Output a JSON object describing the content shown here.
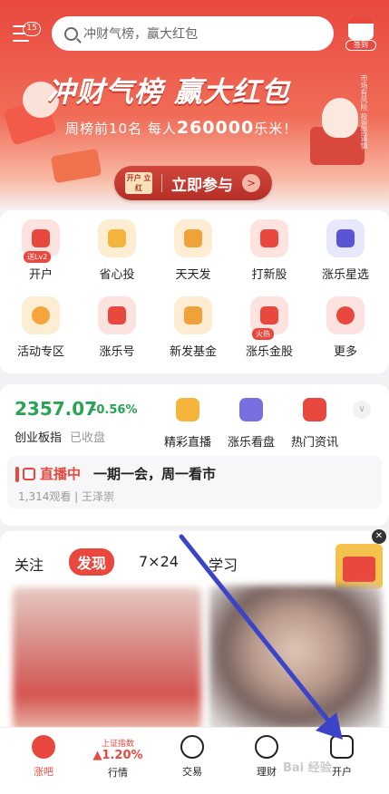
{
  "header": {
    "menu_badge": "15",
    "search_placeholder": "冲财气榜，赢大红包",
    "checkin_label": "签到"
  },
  "banner": {
    "title": "冲财气榜 赢大红包",
    "subtitle_prefix": "周榜前10名  每人",
    "subtitle_amount": "260000",
    "subtitle_suffix": "乐米！",
    "risk_note": "市场有风险 投资需谨慎",
    "join_tag": "开户 立红",
    "join_label": "立即参与"
  },
  "grid": [
    {
      "label": "开户",
      "badge": "送Lv2",
      "color": "#fde3df",
      "inner": "#e8483e"
    },
    {
      "label": "省心投",
      "color": "#fdeed3",
      "inner": "#f5b53c"
    },
    {
      "label": "天天发",
      "color": "#fdeed3",
      "inner": "#f0a23a"
    },
    {
      "label": "打新股",
      "color": "#fde3df",
      "inner": "#e8483e"
    },
    {
      "label": "涨乐星选",
      "color": "#e8e8fb",
      "inner": "#5b55d6"
    },
    {
      "label": "活动专区",
      "color": "#fdeed3",
      "inner": "#f5a53c"
    },
    {
      "label": "涨乐号",
      "color": "#fde3df",
      "inner": "#e8483e"
    },
    {
      "label": "新发基金",
      "color": "#fdeed3",
      "inner": "#f0a23a"
    },
    {
      "label": "涨乐金股",
      "badge": "火热",
      "color": "#fde3df",
      "inner": "#e8483e"
    },
    {
      "label": "更多",
      "color": "#fde3df",
      "inner": "#e8483e"
    }
  ],
  "market": {
    "index_value": "2357.07",
    "index_change": "-0.56%",
    "index_name": "创业板指",
    "index_status": "已收盘",
    "quick": [
      {
        "label": "精彩直播",
        "color": "#f5b53c"
      },
      {
        "label": "涨乐看盘",
        "color": "#7a6fe0"
      },
      {
        "label": "热门资讯",
        "color": "#e8483e"
      }
    ],
    "live_tag": "直播中",
    "live_title": "一期一会，周一看市",
    "live_views": "1,314观看",
    "live_host": "王泽崇"
  },
  "feed": {
    "tabs": [
      "关注",
      "发现",
      "7×24",
      "学习"
    ],
    "active_tab": "发现"
  },
  "nav": {
    "items": [
      "涨吧",
      "交易",
      "理财",
      "开户"
    ],
    "index_name": "上证指数",
    "index_change": "▲1.20%",
    "index_label": "行情"
  },
  "watermark": "Bai 经验"
}
